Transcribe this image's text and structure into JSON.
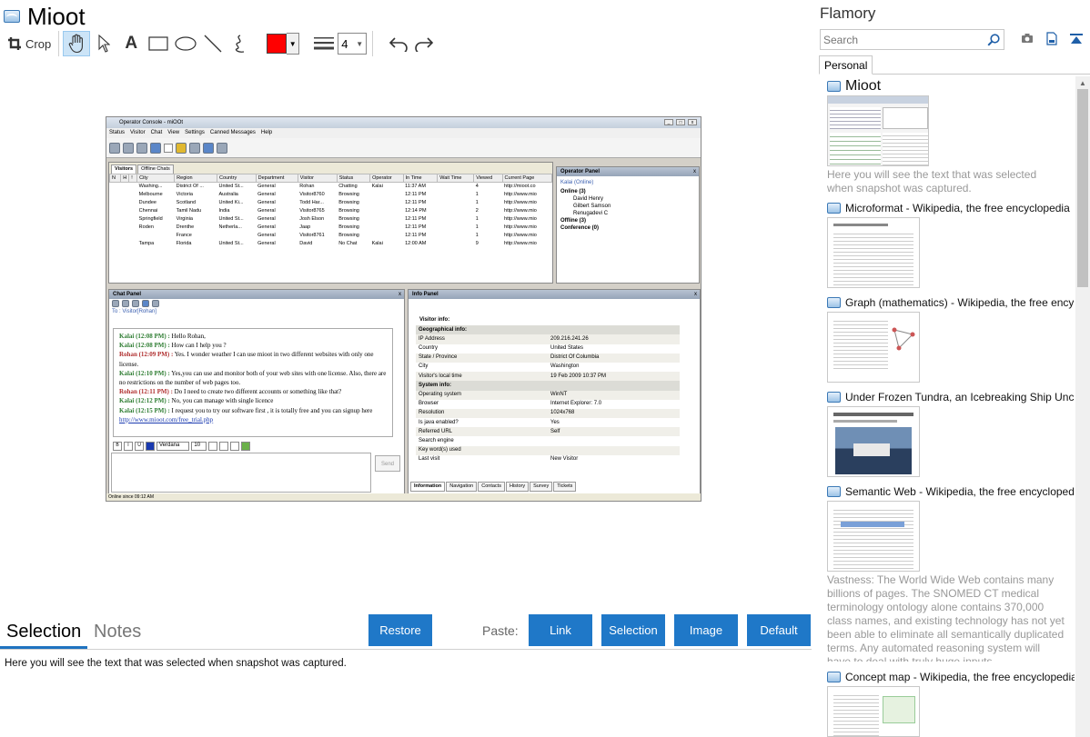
{
  "app": {
    "title": "Mioot"
  },
  "toolbar": {
    "crop_label": "Crop",
    "text_tool_label": "A",
    "stroke_width": "4",
    "color": "#ff0000"
  },
  "screenshot": {
    "window_title": "Operator Console - miOOt",
    "menu": [
      "Status",
      "Visitor",
      "Chat",
      "View",
      "Settings",
      "Canned Messages",
      "Help"
    ],
    "visitors_tabs": [
      "Visitors",
      "Offline Chats"
    ],
    "visitor_columns": [
      "N",
      "H",
      "!",
      "City",
      "Region",
      "Country",
      "Department",
      "Visitor",
      "Status",
      "Operator",
      "In Time",
      "Wait Time",
      "Viewed",
      "Current Page"
    ],
    "visitor_rows": [
      [
        "",
        "",
        "",
        "Washing...",
        "District Of ...",
        "United St...",
        "General",
        "Rohan",
        "Chatting",
        "Kalai",
        "11:37 AM",
        "",
        "4",
        "http://mioot.co"
      ],
      [
        "",
        "",
        "",
        "Melbourne",
        "Victoria",
        "Australia",
        "General",
        "Visitor8760",
        "Browsing",
        "",
        "12:11 PM",
        "",
        "1",
        "http://www.mio"
      ],
      [
        "",
        "",
        "",
        "Dundee",
        "Scotland",
        "United Ki...",
        "General",
        "Todd Har...",
        "Browsing",
        "",
        "12:11 PM",
        "",
        "1",
        "http://www.mio"
      ],
      [
        "",
        "",
        "",
        "Chennai",
        "Tamil Nadu",
        "India",
        "General",
        "Visitor8765",
        "Browsing",
        "",
        "12:14 PM",
        "",
        "2",
        "http://www.mio"
      ],
      [
        "",
        "",
        "",
        "Springfield",
        "Virginia",
        "United St...",
        "General",
        "Josh Elson",
        "Browsing",
        "",
        "12:11 PM",
        "",
        "1",
        "http://www.mio"
      ],
      [
        "",
        "",
        "",
        "Roden",
        "Drenthe",
        "Netherla...",
        "General",
        "Jaap",
        "Browsing",
        "",
        "12:11 PM",
        "",
        "1",
        "http://www.mio"
      ],
      [
        "",
        "",
        "",
        "",
        "France",
        "",
        "General",
        "Visitor8761",
        "Browsing",
        "",
        "12:11 PM",
        "",
        "1",
        "http://www.mio"
      ],
      [
        "",
        "",
        "",
        "Tampa",
        "Florida",
        "United St...",
        "General",
        "David",
        "No Chat",
        "Kalai",
        "12:00 AM",
        "",
        "9",
        "http://www.mio"
      ]
    ],
    "operator_panel": {
      "title": "Operator Panel",
      "me": "Kalai (Online)",
      "online_group": "Online (3)",
      "online": [
        "David Henry",
        "Gilbert Samson",
        "Renugadevi C"
      ],
      "offline_group": "Offline (3)",
      "conference_group": "Conference (0)"
    },
    "chat_panel": {
      "title": "Chat Panel",
      "to": "To : Visitor[Rohan]",
      "font": "Verdana",
      "size": "10",
      "send_label": "Send",
      "lines": [
        {
          "speaker": "Kalai (12:08 PM) :",
          "who": "k",
          "text": " Hello Rohan,"
        },
        {
          "speaker": "Kalai (12:08 PM) :",
          "who": "k",
          "text": " How can I help you ?"
        },
        {
          "speaker": "Rohan (12:09 PM) :",
          "who": "r",
          "text": " Yes. I wonder weather I can use mioot in two different websites with only one license."
        },
        {
          "speaker": "Kalai (12:10 PM) :",
          "who": "k",
          "text": " Yes,you can use and monitor both of your web sites with one license. Also, there are no restrictions on the number of web pages too."
        },
        {
          "speaker": "Rohan (12:11 PM) :",
          "who": "r",
          "text": " Do I need to create two different accounts or something like that?"
        },
        {
          "speaker": "Kalai (12:12 PM) :",
          "who": "k",
          "text": " No, you can manage with single licence"
        },
        {
          "speaker": "Kalai (12:15 PM) :",
          "who": "k",
          "text": " I request you to try our software first , it is totally free and you can signup here "
        }
      ],
      "signup_link": "http://www.mioot.com/free_trial.php"
    },
    "info_panel": {
      "title": "Info Panel",
      "visitor_info": "Visitor info:",
      "geo_header": "Geographical info:",
      "geo_rows": [
        [
          "IP Address",
          "209.216.241.26"
        ],
        [
          "Country",
          "United States"
        ],
        [
          "State / Province",
          "District Of Columbia"
        ],
        [
          "City",
          "Washington"
        ],
        [
          "Visitor's local time",
          "19 Feb 2009 10:37 PM"
        ]
      ],
      "sys_header": "System info:",
      "sys_rows": [
        [
          "Operating system",
          "WinNT"
        ],
        [
          "Browser",
          "Internet Explorer: 7.0"
        ],
        [
          "Resolution",
          "1024x768"
        ],
        [
          "Is java enabled?",
          "Yes"
        ],
        [
          "Referred URL",
          "Self"
        ],
        [
          "Search engine",
          ""
        ],
        [
          "Key word(s) used",
          ""
        ],
        [
          "Last visit",
          "New Visitor"
        ]
      ],
      "tabs": [
        "Information",
        "Navigation",
        "Contacts",
        "History",
        "Survey",
        "Tickets"
      ]
    },
    "status_bar": "Online since 09:12 AM"
  },
  "bottom": {
    "tab_selection": "Selection",
    "tab_notes": "Notes",
    "restore_label": "Restore",
    "paste_label": "Paste:",
    "paste_buttons": [
      "Link",
      "Selection",
      "Image",
      "Default"
    ],
    "selection_text": "Here you will see the text that was selected when snapshot was captured."
  },
  "sidebar": {
    "brand": "Flamory",
    "search_placeholder": "Search",
    "tab_personal": "Personal",
    "items": [
      {
        "title": "Mioot",
        "desc": "Here you will see the text that was selected when snapshot was captured."
      },
      {
        "title": "Microformat - Wikipedia, the free encyclopedia",
        "desc": ""
      },
      {
        "title": "Graph (mathematics) - Wikipedia, the free ency",
        "desc": ""
      },
      {
        "title": "Under Frozen Tundra, an Icebreaking Ship Unco",
        "desc": ""
      },
      {
        "title": "Semantic Web - Wikipedia, the free encycloped",
        "desc": "Vastness: The World Wide Web contains many billions of pages. The SNOMED CT medical terminology ontology alone contains 370,000 class names, and existing technology has not yet been able to eliminate all semantically duplicated terms. Any automated reasoning system will have to deal with truly huge inputs."
      },
      {
        "title": "Concept map - Wikipedia, the free encyclopedia",
        "desc": ""
      }
    ]
  },
  "colors": {
    "accent": "#1f78c8",
    "tab_underline": "#1f73c0"
  }
}
